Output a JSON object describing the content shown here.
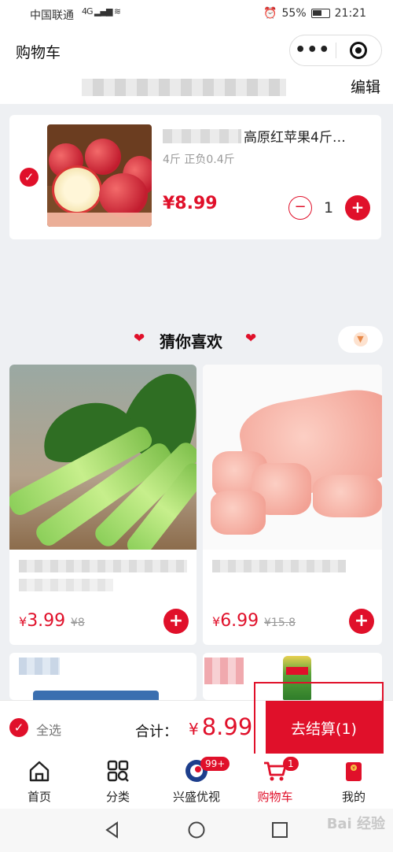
{
  "status_bar": {
    "carrier": "中国联通",
    "network": "4G",
    "battery": "55%",
    "time": "21:21"
  },
  "header": {
    "title": "购物车"
  },
  "store": {
    "edit_label": "编辑"
  },
  "cart_item": {
    "name": "高原红苹果4斤…",
    "spec": "4斤 正负0.4斤",
    "price": "¥8.99",
    "quantity": "1"
  },
  "recommend": {
    "title": "猜你喜欢",
    "products": [
      {
        "price_symbol": "¥",
        "price": "3.99",
        "old_price": "¥8"
      },
      {
        "price_symbol": "¥",
        "price": "6.99",
        "old_price": "¥15.8"
      }
    ]
  },
  "checkout": {
    "select_all": "全选",
    "total_label": "合计：",
    "total_symbol": "¥",
    "total_value": "8.99",
    "button_label": "去结算(1)"
  },
  "tabbar": {
    "items": [
      {
        "label": "首页",
        "icon": "home-icon"
      },
      {
        "label": "分类",
        "icon": "category-icon"
      },
      {
        "label": "兴盛优视",
        "icon": "video-icon",
        "badge": "99+"
      },
      {
        "label": "购物车",
        "icon": "cart-icon",
        "badge": "1"
      },
      {
        "label": "我的",
        "icon": "profile-icon"
      }
    ]
  },
  "watermark": "Bai 经验",
  "colors": {
    "accent": "#e0102a",
    "background": "#eef0f3"
  }
}
